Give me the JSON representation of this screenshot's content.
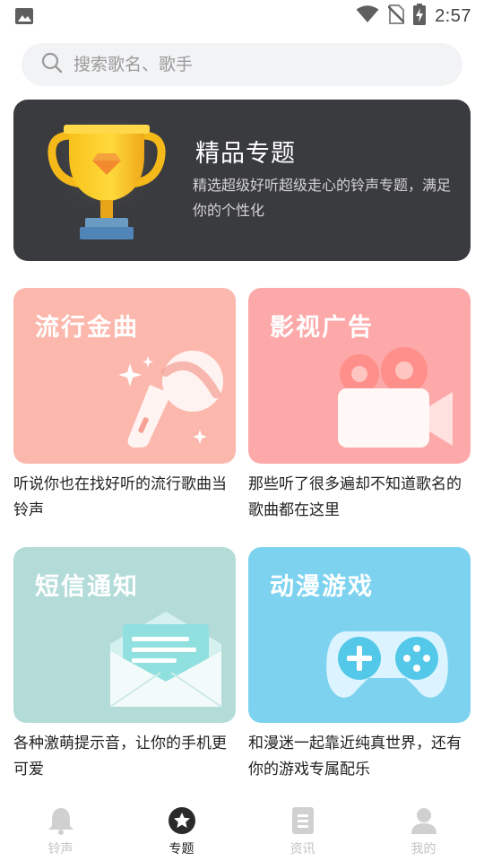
{
  "status_bar": {
    "time": "2:57",
    "icons": [
      "image-icon",
      "wifi-icon",
      "no-sim-icon",
      "battery-charging-icon"
    ]
  },
  "search": {
    "placeholder": "搜索歌名、歌手",
    "value": ""
  },
  "banner": {
    "title": "精品专题",
    "description": "精选超级好听超级走心的铃声专题，满足你的个性化",
    "icon": "trophy-icon"
  },
  "categories": [
    {
      "title": "流行金曲",
      "description": "听说你也在找好听的流行歌曲当铃声",
      "icon": "microphone-icon",
      "color": "#fcb8ad"
    },
    {
      "title": "影视广告",
      "description": "那些听了很多遍却不知道歌名的歌曲都在这里",
      "icon": "movie-camera-icon",
      "color": "#fda9a9"
    },
    {
      "title": "短信通知",
      "description": "各种激萌提示音，让你的手机更可爱",
      "icon": "envelope-icon",
      "color": "#b3dcd9"
    },
    {
      "title": "动漫游戏",
      "description": "和漫迷一起靠近纯真世界，还有你的游戏专属配乐",
      "icon": "gamepad-icon",
      "color": "#7dd3ef"
    }
  ],
  "tabs": [
    {
      "label": "铃声",
      "icon": "bell-icon",
      "active": false
    },
    {
      "label": "专题",
      "icon": "star-circle-icon",
      "active": true
    },
    {
      "label": "资讯",
      "icon": "document-icon",
      "active": false
    },
    {
      "label": "我的",
      "icon": "person-icon",
      "active": false
    }
  ]
}
